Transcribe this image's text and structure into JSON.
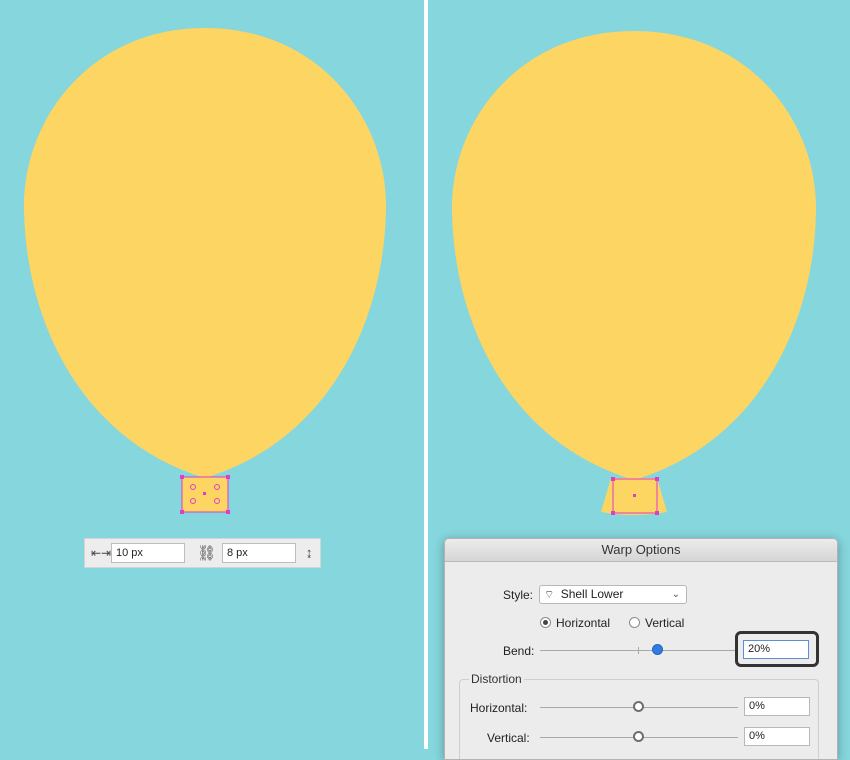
{
  "colors": {
    "background": "#85d6dd",
    "balloon": "#fdd563",
    "selection": "#e03cc6",
    "slider_accent": "#2f7de1"
  },
  "transform_bar": {
    "width_icon": "width-arrows-icon",
    "width_value": "10 px",
    "link_icon": "unlink-chain-icon",
    "height_value": "8 px",
    "height_icon": "height-arrows-icon"
  },
  "warp_dialog": {
    "title": "Warp Options",
    "style_label": "Style:",
    "style_icon": "shell-lower-icon",
    "style_value": "Shell Lower",
    "orientation_horizontal": "Horizontal",
    "orientation_vertical": "Vertical",
    "orientation_selected": "Horizontal",
    "bend_label": "Bend:",
    "bend_value": "20%",
    "bend_level": 20,
    "distortion_title": "Distortion",
    "distortion_horizontal_label": "Horizontal:",
    "distortion_horizontal_value": "0%",
    "distortion_vertical_label": "Vertical:",
    "distortion_vertical_value": "0%"
  }
}
